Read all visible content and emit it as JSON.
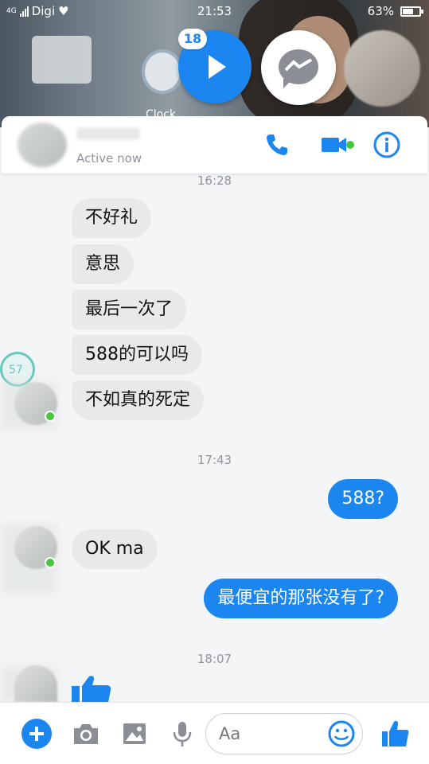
{
  "status_bar": {
    "network_label": "4G",
    "carrier": "Digi",
    "time": "21:53",
    "battery_percent": "63%",
    "battery_level": 0.63
  },
  "chat_heads": {
    "badge_count": "18",
    "wallpaper_label": "Clock"
  },
  "header": {
    "status": "Active now",
    "online": true
  },
  "conversation": {
    "timestamps": [
      "16:28",
      "17:43",
      "18:07"
    ],
    "messages": [
      {
        "direction": "in",
        "text": "不好礼"
      },
      {
        "direction": "in",
        "text": "意思"
      },
      {
        "direction": "in",
        "text": "最后一次了"
      },
      {
        "direction": "in",
        "text": "588的可以吗"
      },
      {
        "direction": "in",
        "text": "不如真的死定"
      },
      {
        "direction": "out",
        "text": "588?"
      },
      {
        "direction": "in",
        "text": "OK ma"
      },
      {
        "direction": "out",
        "text": "最便宜的那张没有了?"
      }
    ],
    "floating_badge": "57"
  },
  "composer": {
    "placeholder": "Aa"
  },
  "colors": {
    "accent": "#1b86f0",
    "incoming_bubble": "#e9e9eb",
    "online_green": "#48c53f"
  },
  "icons": [
    "play-icon",
    "messenger-icon",
    "phone-icon",
    "video-camera-icon",
    "info-icon",
    "plus-icon",
    "camera-icon",
    "image-icon",
    "microphone-icon",
    "emoji-icon",
    "thumbs-up-icon"
  ]
}
